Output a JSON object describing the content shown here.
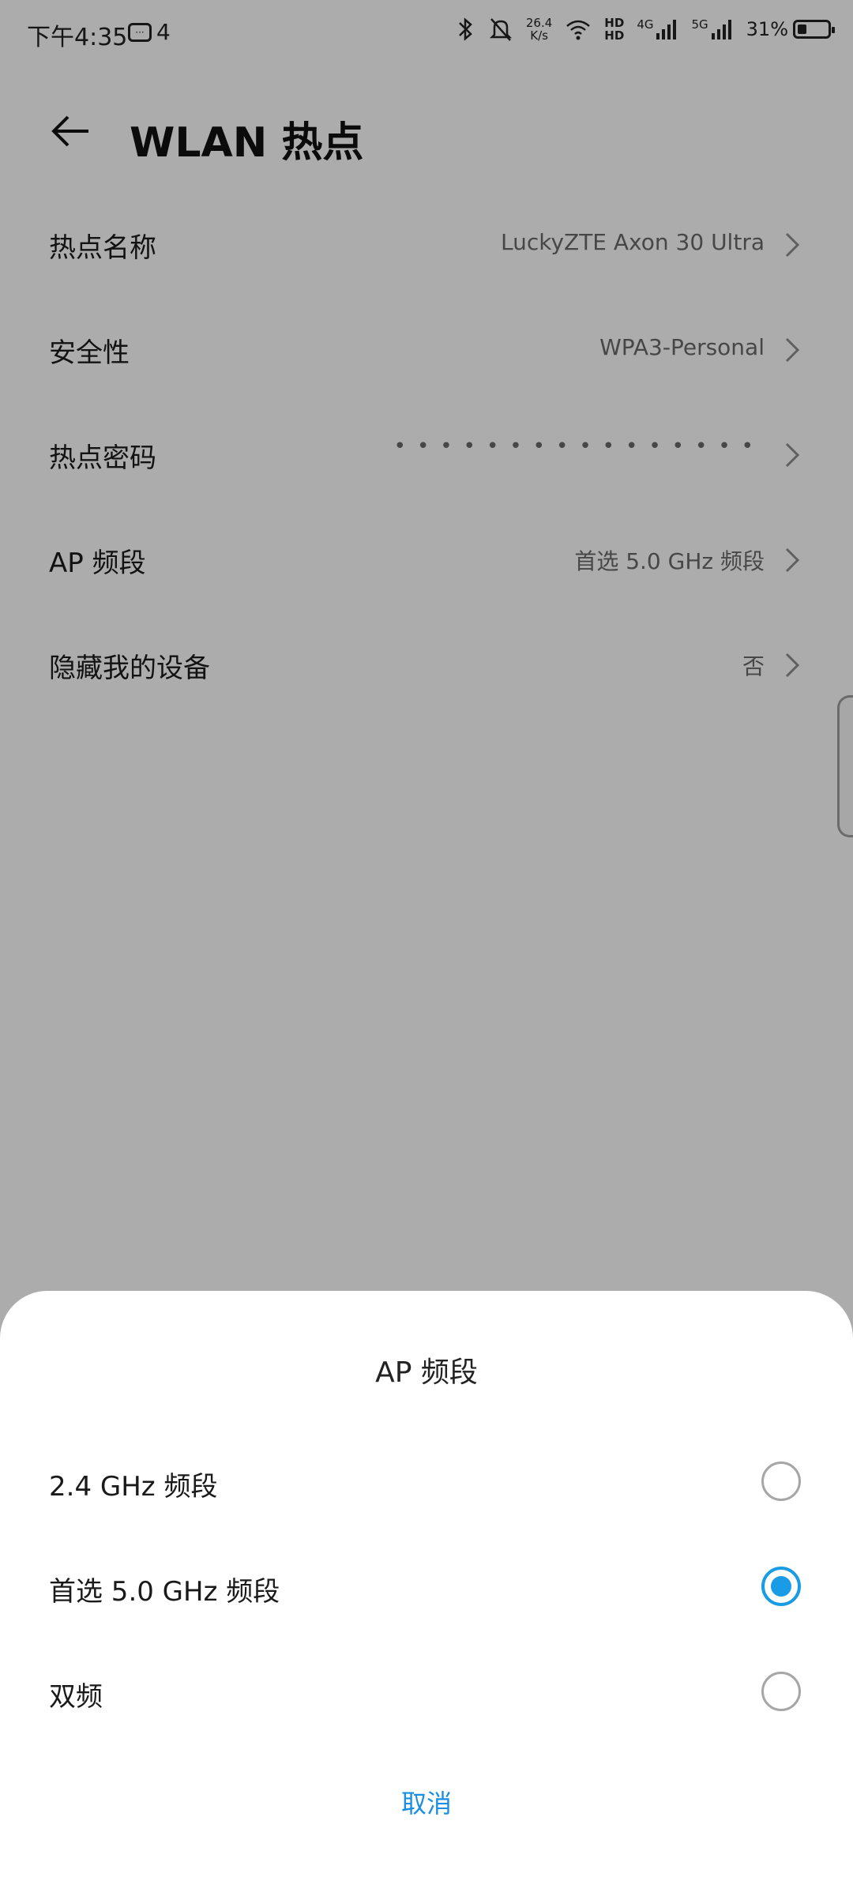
{
  "status_bar": {
    "time": "下午4:35",
    "notification_count": "4",
    "net_speed": "26.4",
    "net_speed_unit": "K/s",
    "hd1": "HD",
    "hd2": "HD",
    "signal_4g": "4G",
    "signal_5g": "5G",
    "battery_percent": "31%",
    "battery_level": 0.31,
    "icons": [
      "bluetooth-icon",
      "bell-off-icon",
      "wifi-icon",
      "signal-icon",
      "battery-icon"
    ]
  },
  "header": {
    "title": "WLAN 热点"
  },
  "settings": [
    {
      "label": "热点名称",
      "value": "LuckyZTE Axon 30 Ultra"
    },
    {
      "label": "安全性",
      "value": "WPA3-Personal"
    },
    {
      "label": "热点密码",
      "value": "••••••••••••••••"
    },
    {
      "label": "AP 频段",
      "value": "首选 5.0 GHz 频段"
    },
    {
      "label": "隐藏我的设备",
      "value": "否"
    }
  ],
  "sheet": {
    "title": "AP 频段",
    "options": [
      {
        "label": "2.4 GHz 频段",
        "selected": false
      },
      {
        "label": "首选 5.0 GHz 频段",
        "selected": true
      },
      {
        "label": "双频",
        "selected": false
      }
    ],
    "cancel_label": "取消"
  },
  "colors": {
    "accent": "#1a9be6",
    "link": "#1a8ee0",
    "scrim": "rgba(0,0,0,0.30)"
  }
}
